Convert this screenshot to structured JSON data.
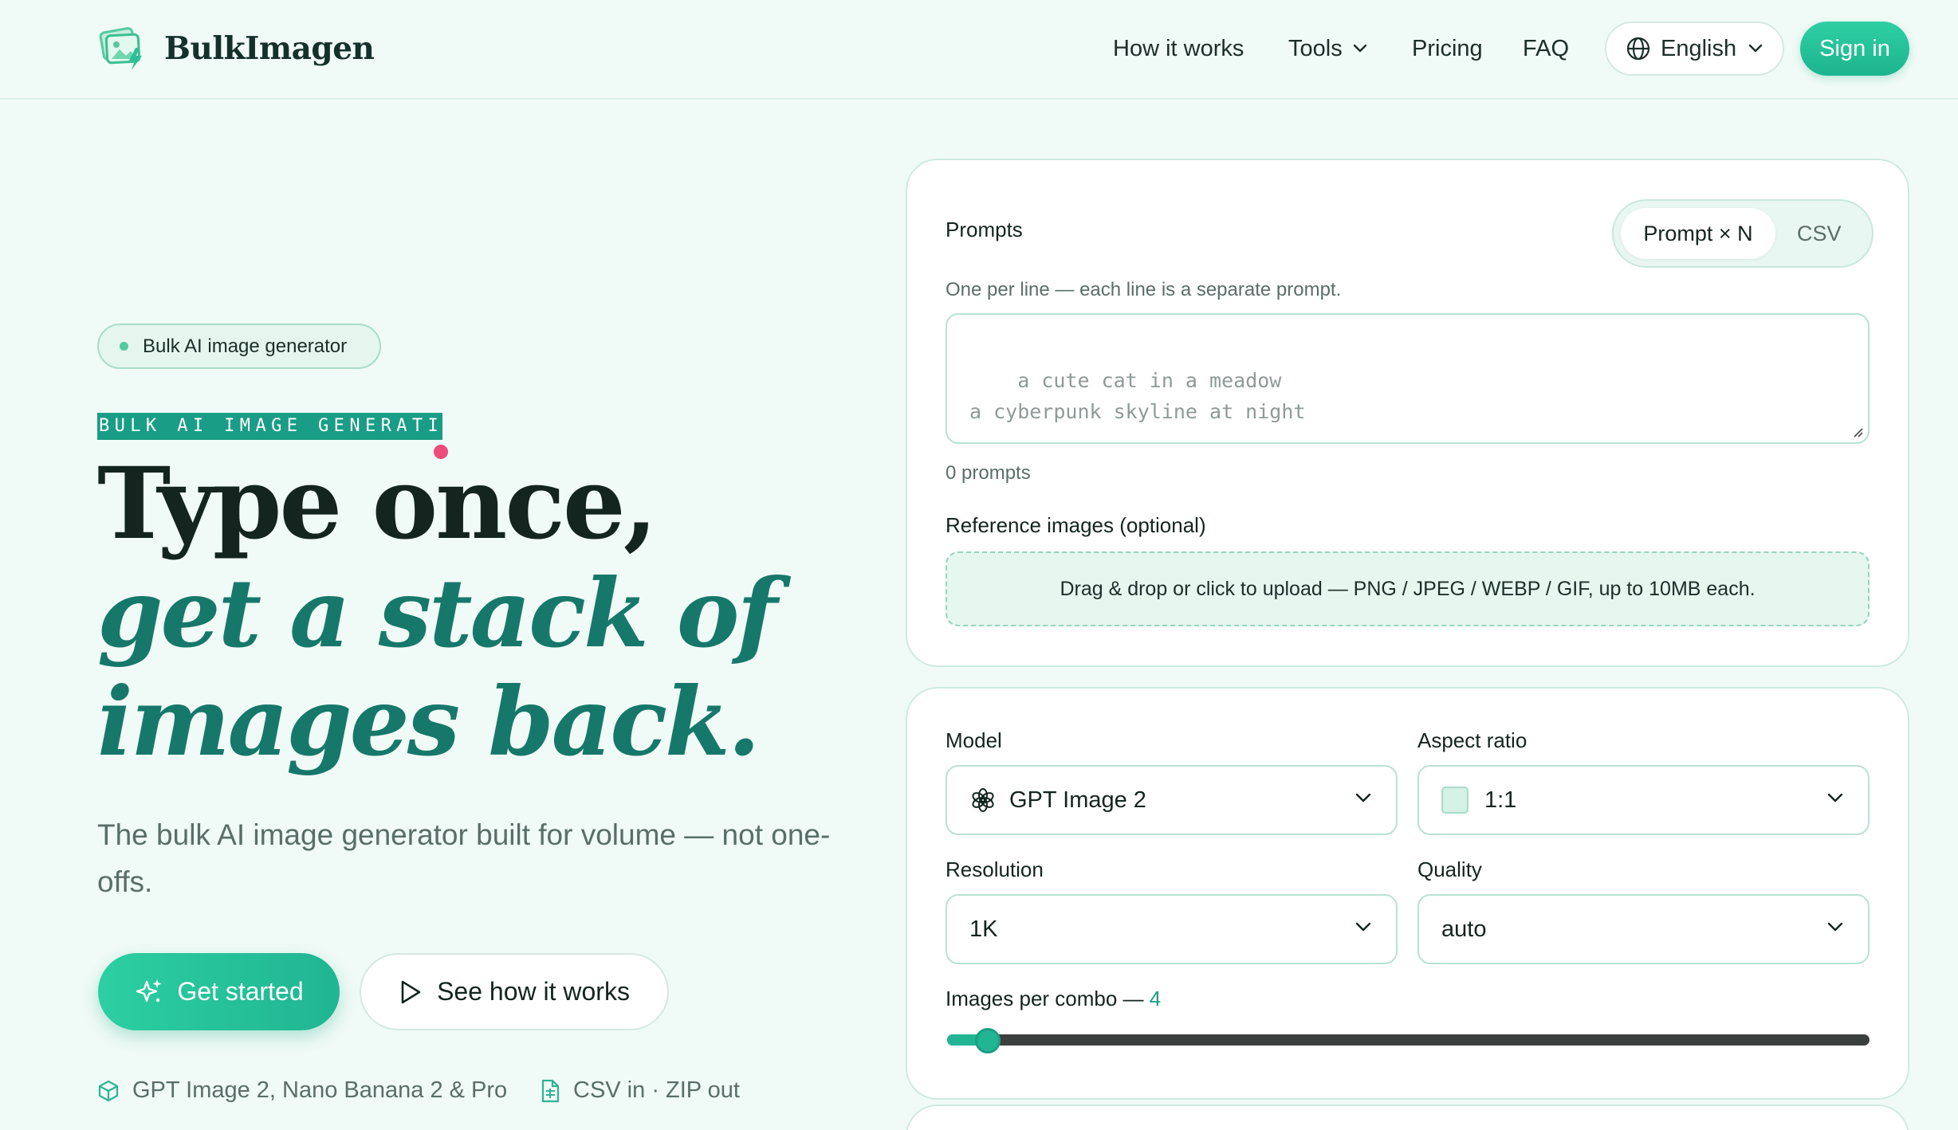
{
  "header": {
    "brand": "BulkImagen",
    "nav": {
      "how": "How it works",
      "tools": "Tools",
      "pricing": "Pricing",
      "faq": "FAQ"
    },
    "language": "English",
    "signin": "Sign in"
  },
  "hero": {
    "pill": "Bulk AI image generator",
    "eyebrow": "BULK AI IMAGE GENERATION",
    "title_line1": "Type once,",
    "title_line2": "get a stack of",
    "title_line3": "images back.",
    "subtitle": "The bulk AI image generator built for volume — not one-offs.",
    "cta_primary": "Get started",
    "cta_secondary": "See how it works",
    "features": [
      "GPT Image 2, Nano Banana 2 & Pro",
      "CSV in · ZIP out"
    ]
  },
  "prompts_card": {
    "label": "Prompts",
    "mode_toggle": {
      "active": "Prompt × N",
      "inactive": "CSV"
    },
    "helper": "One per line — each line is a separate prompt.",
    "placeholder": "a cute cat in a meadow\na cyberpunk skyline at night",
    "count": "0 prompts",
    "reference_label": "Reference images (optional)",
    "dropzone_text": "Drag & drop or click to upload — PNG / JPEG / WEBP / GIF, up to 10MB each."
  },
  "settings_card": {
    "model": {
      "label": "Model",
      "value": "GPT Image 2"
    },
    "aspect_ratio": {
      "label": "Aspect ratio",
      "value": "1:1"
    },
    "resolution": {
      "label": "Resolution",
      "value": "1K"
    },
    "quality": {
      "label": "Quality",
      "value": "auto"
    },
    "images_per_combo": {
      "label": "Images per combo —",
      "value": "4",
      "level_fraction": 0.03
    }
  },
  "colors": {
    "accent": "#1a9d86",
    "brand_button": "#22bf97",
    "heading_dark": "#14241f",
    "heading_teal": "#16786a",
    "background": "#f0faf6"
  }
}
